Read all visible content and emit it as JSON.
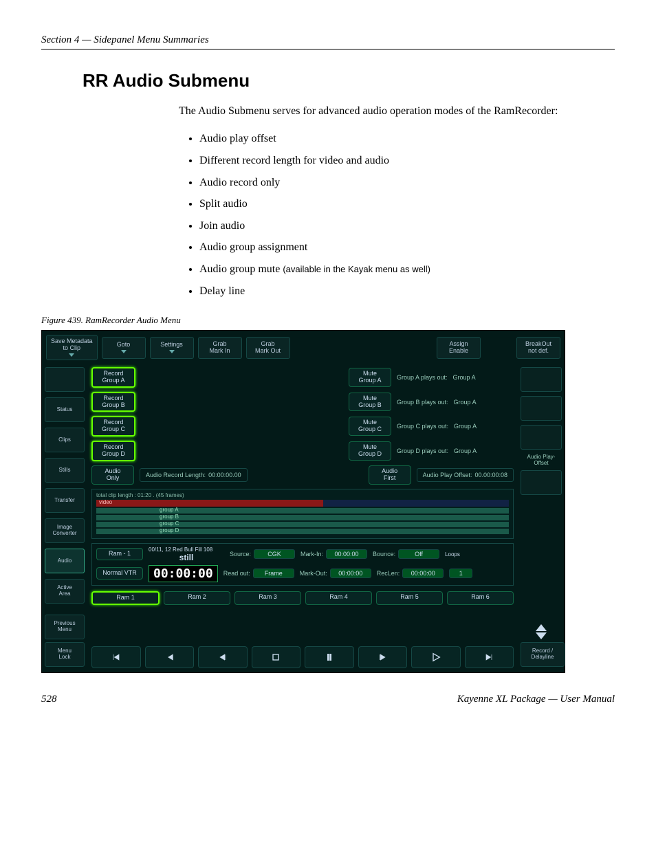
{
  "page": {
    "section_header": "Section 4 — Sidepanel Menu Summaries",
    "title": "RR Audio Submenu",
    "intro": "The Audio Submenu serves for advanced audio operation modes of the RamRecorder:",
    "bullets": [
      "Audio play offset",
      "Different record length for video and audio",
      "Audio record only",
      "Split audio",
      "Join audio",
      "Audio group assignment",
      "Audio group mute",
      "Delay line"
    ],
    "bullet6_suffix": "(available in the Kayak menu as well)",
    "figure_caption": "Figure 439.  RamRecorder Audio Menu",
    "page_number": "528",
    "footer_right": "Kayenne XL Package — User Manual"
  },
  "toolbar": {
    "save_metadata": "Save Metadata\nto Clip",
    "goto": "Goto",
    "settings": "Settings",
    "grab_mark_in": "Grab\nMark In",
    "grab_mark_out": "Grab\nMark Out",
    "assign_enable": "Assign\nEnable",
    "breakout": "BreakOut\nnot def."
  },
  "leftnav": {
    "items": [
      "",
      "Status",
      "Clips",
      "Stills",
      "Transfer",
      "Image\nConverter",
      "Audio",
      "Active\nArea",
      "",
      "Previous\nMenu",
      "Menu\nLock"
    ],
    "selected_index": 6
  },
  "groups": [
    {
      "rec": "Record\nGroup A",
      "mute": "Mute\nGroup A",
      "plays_lbl": "Group A plays out:",
      "plays_val": "Group A"
    },
    {
      "rec": "Record\nGroup B",
      "mute": "Mute\nGroup B",
      "plays_lbl": "Group B plays out:",
      "plays_val": "Group A"
    },
    {
      "rec": "Record\nGroup C",
      "mute": "Mute\nGroup C",
      "plays_lbl": "Group C plays out:",
      "plays_val": "Group A"
    },
    {
      "rec": "Record\nGroup D",
      "mute": "Mute\nGroup D",
      "plays_lbl": "Group D plays out:",
      "plays_val": "Group A"
    }
  ],
  "audio_row": {
    "audio_only": "Audio\nOnly",
    "rec_len_lbl": "Audio Record Length:",
    "rec_len_val": "00:00:00.00",
    "audio_first": "Audio\nFirst",
    "play_off_lbl": "Audio Play Offset:",
    "play_off_val": "00.00:00:08"
  },
  "timeline": {
    "total": "total clip length : 01:20 . (45 frames)",
    "tracks": [
      "video",
      "group A",
      "group B",
      "group C",
      "group D"
    ]
  },
  "status": {
    "ram_sel": "Ram - 1",
    "clip": "00/11, 12 Red Bull Fill 108",
    "still": "still",
    "mode": "Normal VTR",
    "time": "00:00:00",
    "source_lbl": "Source:",
    "source_val": "CGK",
    "readout_lbl": "Read out:",
    "readout_val": "Frame",
    "markin_lbl": "Mark-In:",
    "markin_val": "00:00:00",
    "markout_lbl": "Mark-Out:",
    "markout_val": "00:00:00",
    "bounce_lbl": "Bounce:",
    "bounce_val": "Off",
    "reclen_lbl": "RecLen:",
    "reclen_val": "00:00:00",
    "loops_lbl": "Loops",
    "loops_val": "1"
  },
  "ramtabs": [
    "Ram 1",
    "Ram 2",
    "Ram 3",
    "Ram 4",
    "Ram 5",
    "Ram 6"
  ],
  "right": {
    "audio_play_offset": "Audio Play-\nOffset",
    "record_delay": "Record /\nDelayline"
  }
}
